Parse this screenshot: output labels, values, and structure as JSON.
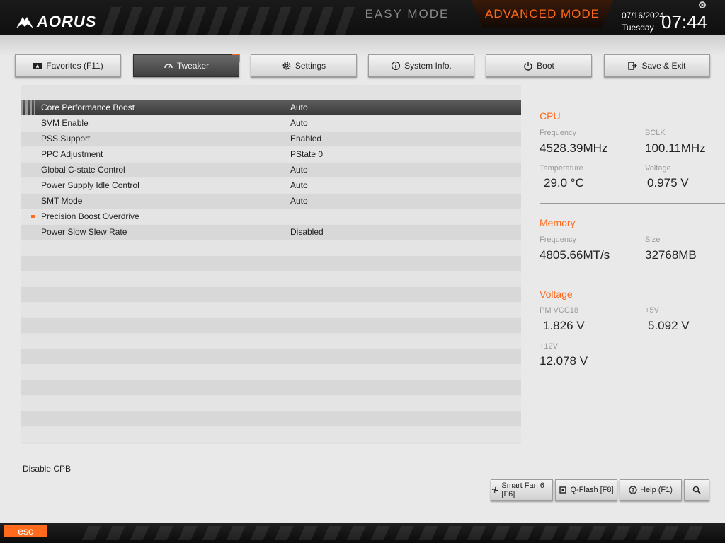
{
  "header": {
    "logo": "AORUS",
    "easy_mode": "EASY MODE",
    "advanced_mode": "ADVANCED MODE",
    "date": "07/16/2024",
    "day": "Tuesday",
    "time": "07:44"
  },
  "tabs": [
    {
      "label": "Favorites (F11)",
      "icon": "favorites-icon"
    },
    {
      "label": "Tweaker",
      "icon": "gauge-icon"
    },
    {
      "label": "Settings",
      "icon": "gear-icon"
    },
    {
      "label": "System Info.",
      "icon": "info-icon"
    },
    {
      "label": "Boot",
      "icon": "power-icon"
    },
    {
      "label": "Save & Exit",
      "icon": "exit-icon"
    }
  ],
  "active_tab": "Tweaker",
  "settings": [
    {
      "label": "Core Performance Boost",
      "value": "Auto"
    },
    {
      "label": "SVM Enable",
      "value": "Auto"
    },
    {
      "label": "PSS Support",
      "value": "Enabled"
    },
    {
      "label": "PPC Adjustment",
      "value": "PState 0"
    },
    {
      "label": "Global C-state Control",
      "value": "Auto"
    },
    {
      "label": "Power Supply Idle Control",
      "value": "Auto"
    },
    {
      "label": "SMT Mode",
      "value": "Auto"
    },
    {
      "label": "Precision Boost Overdrive",
      "value": ""
    },
    {
      "label": "Power Slow Slew Rate",
      "value": "Disabled"
    }
  ],
  "info": {
    "cpu": {
      "title": "CPU",
      "frequency_label": "Frequency",
      "frequency": "4528.39MHz",
      "bclk_label": "BCLK",
      "bclk": "100.11MHz",
      "temperature_label": "Temperature",
      "temperature": "29.0 °C",
      "voltage_label": "Voltage",
      "voltage": "0.975 V"
    },
    "memory": {
      "title": "Memory",
      "frequency_label": "Frequency",
      "frequency": "4805.66MT/s",
      "size_label": "Size",
      "size": "32768MB"
    },
    "voltage": {
      "title": "Voltage",
      "pm_vcc18_label": "PM VCC18",
      "pm_vcc18": "1.826 V",
      "p5v_label": "+5V",
      "p5v": "5.092 V",
      "p12v_label": "+12V",
      "p12v": "12.078 V"
    }
  },
  "help_text": "Disable CPB",
  "bottom_buttons": {
    "smart_fan": "Smart Fan 6 [F6]",
    "qflash": "Q-Flash [F8]",
    "help": "Help (F1)"
  },
  "esc_label": "esc",
  "colors": {
    "accent": "#ff6a1c",
    "topbar": "#111111",
    "background": "#e9e9e9"
  }
}
